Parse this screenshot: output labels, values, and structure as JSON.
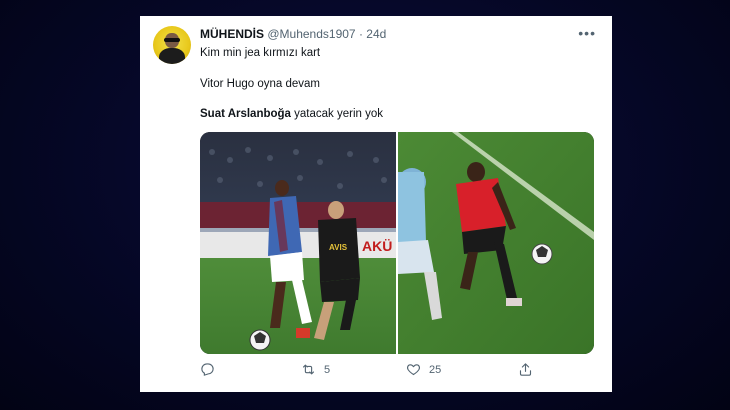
{
  "tweet": {
    "author_name": "MÜHENDİS",
    "author_handle": "@Muhends1907",
    "separator": "·",
    "time": "24d",
    "more_icon": "more-icon",
    "line1": "Kim min jea kırmızı kart",
    "line2": "Vitor Hugo oyna devam",
    "line3_bold": "Suat Arslanboğa",
    "line3_rest": " yatacak yerin yok",
    "media": [
      {
        "description_icon": "football-photo-left",
        "ad_text": "AKÜ"
      },
      {
        "description_icon": "football-photo-right"
      }
    ],
    "actions": {
      "reply_count": "",
      "retweet_count": "5",
      "like_count": "25",
      "share_count": ""
    }
  },
  "colors": {
    "background": "#06082a",
    "card": "#ffffff",
    "text_primary": "#0f1419",
    "text_secondary": "#536471"
  }
}
